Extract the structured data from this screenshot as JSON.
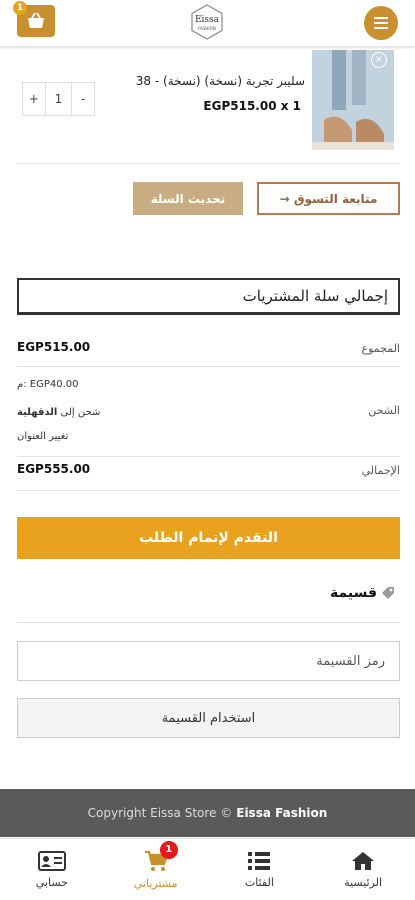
{
  "header": {
    "cart_count": "1",
    "logo_text": "Eissa",
    "logo_sub": "FASHION"
  },
  "cart_item": {
    "name": "سليبر تجربة (نسخة) (نسخة) - 38",
    "price": "EGP515.00 x 1",
    "quantity": "1",
    "qty_plus": "+",
    "qty_minus": "-",
    "remove": "×"
  },
  "actions": {
    "update_cart": "تحديث السلة",
    "continue_shopping": "→ متابعة التسوق"
  },
  "totals": {
    "title": "إجمالي سلة المشتريات",
    "subtotal_label": "المجموع",
    "subtotal_value": "EGP515.00",
    "shipping_label": "الشحن",
    "shipping_rate": "م: EGP40.00",
    "shipping_to_prefix": "شحن إلى",
    "shipping_to_place": "الدقهلية",
    "change_address": "تغيير العنوان",
    "total_label": "الإجمالي",
    "total_value": "EGP555.00"
  },
  "checkout_label": "التقدم لإتمام الطلب",
  "coupon": {
    "title": "قسيمة",
    "placeholder": "رمز القسيمة",
    "apply_label": "استخدام القسيمة"
  },
  "footer": {
    "copyright": "Copyright Eissa Store ©",
    "brand": "Eissa Fashion"
  },
  "bottom_nav": [
    {
      "label": "حسابي",
      "icon": "account-card-icon"
    },
    {
      "label": "مشترياتي",
      "icon": "cart-icon",
      "badge": "1"
    },
    {
      "label": "الفئات",
      "icon": "list-icon"
    },
    {
      "label": "الرئيسية",
      "icon": "home-icon"
    }
  ],
  "colors": {
    "accent": "#c8902e",
    "checkout": "#e8a21d",
    "update": "#c9ad82",
    "footer": "#5a5a5a",
    "badge": "#e21b1b"
  }
}
